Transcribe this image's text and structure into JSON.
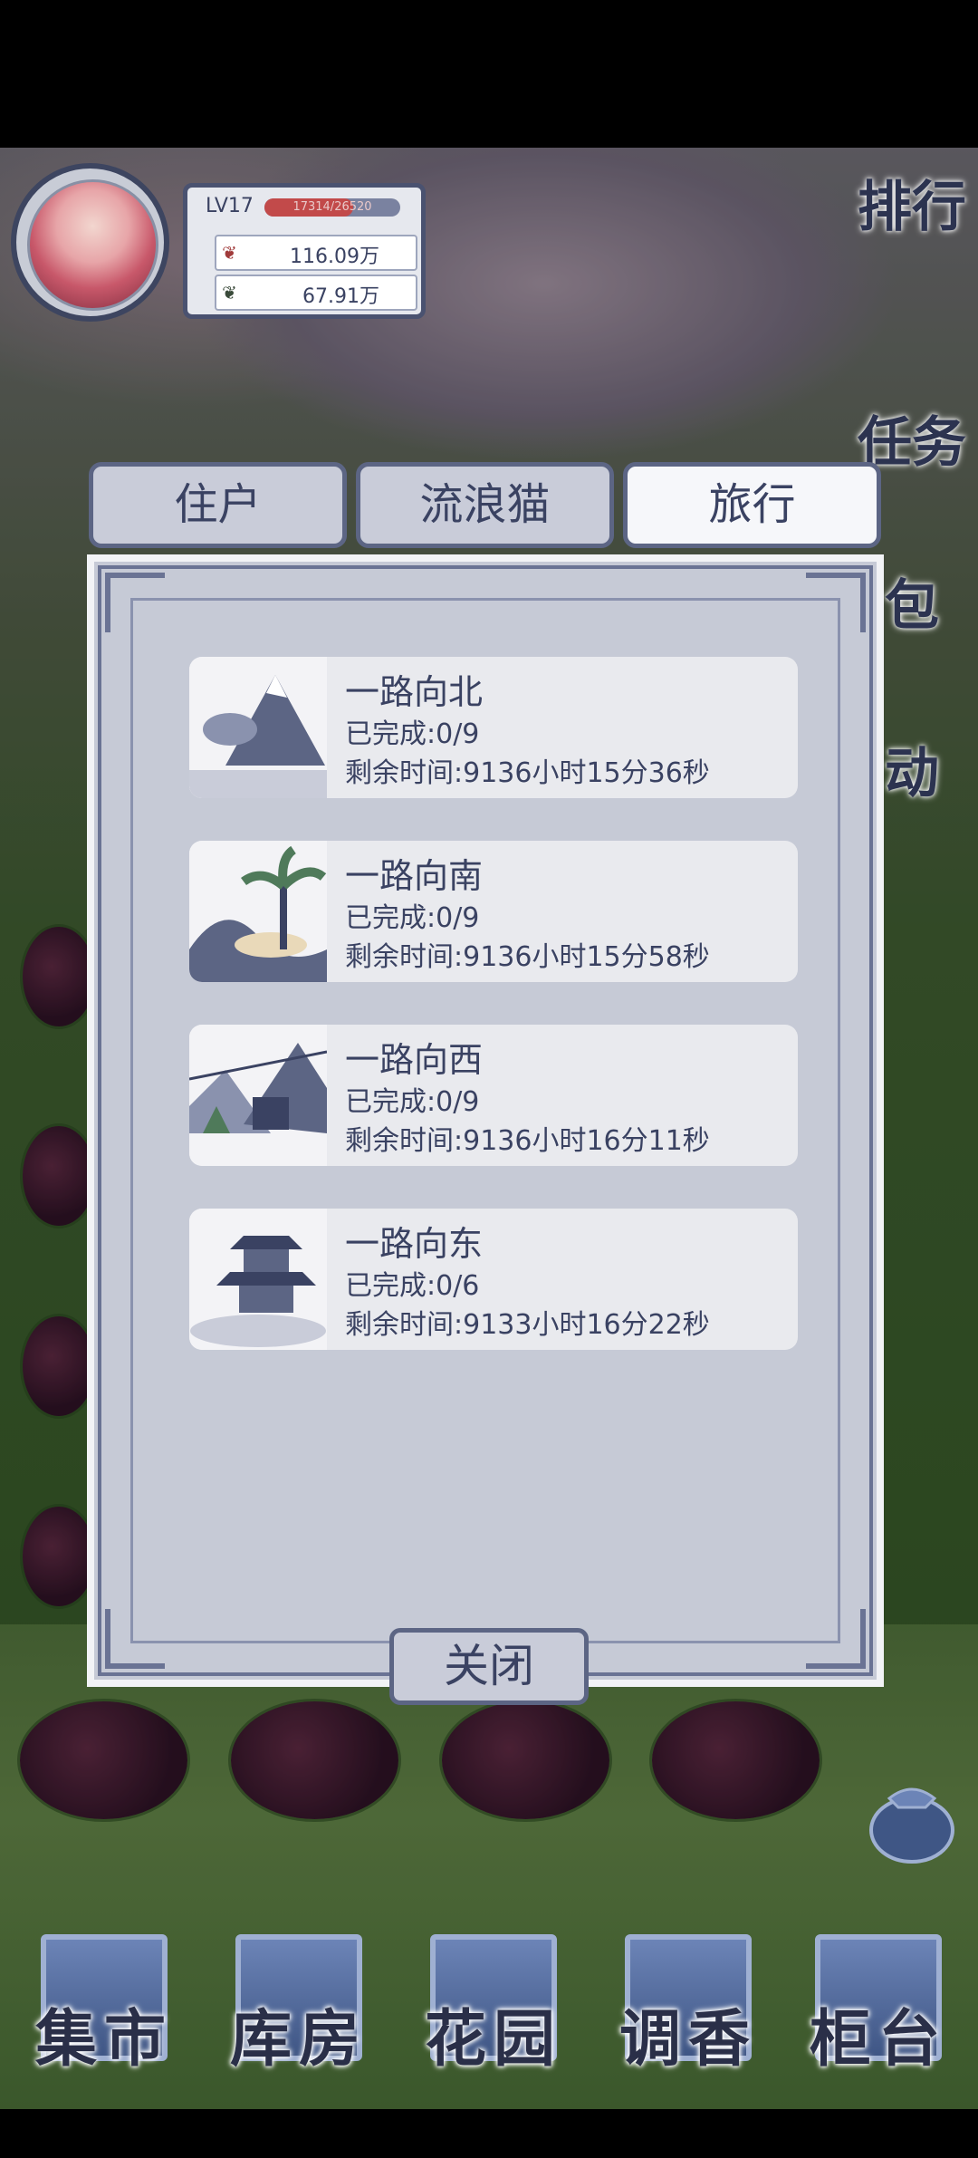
{
  "player": {
    "level": "LV17",
    "xp_text": "17314/26520",
    "xp_fraction": 0.65,
    "currency_red": "116.09万",
    "currency_green": "67.91万"
  },
  "side_menu": {
    "ranking": "排行",
    "tasks": "任务",
    "bag": "包",
    "activity": "动"
  },
  "tabs": [
    {
      "label": "住户",
      "active": false
    },
    {
      "label": "流浪猫",
      "active": false
    },
    {
      "label": "旅行",
      "active": true
    }
  ],
  "travel_items": [
    {
      "title": "一路向北",
      "completed": "已完成:0/9",
      "remaining": "剩余时间:9136小时15分36秒",
      "icon": "mountain-fish-icon"
    },
    {
      "title": "一路向南",
      "completed": "已完成:0/9",
      "remaining": "剩余时间:9136小时15分58秒",
      "icon": "palm-wave-icon"
    },
    {
      "title": "一路向西",
      "completed": "已完成:0/9",
      "remaining": "剩余时间:9136小时16分11秒",
      "icon": "cable-car-icon"
    },
    {
      "title": "一路向东",
      "completed": "已完成:0/6",
      "remaining": "剩余时间:9133小时16分22秒",
      "icon": "pagoda-icon"
    }
  ],
  "close_label": "关闭",
  "bottom_nav": [
    {
      "label": "集市"
    },
    {
      "label": "库房"
    },
    {
      "label": "花园"
    },
    {
      "label": "调香"
    },
    {
      "label": "柜台"
    }
  ]
}
